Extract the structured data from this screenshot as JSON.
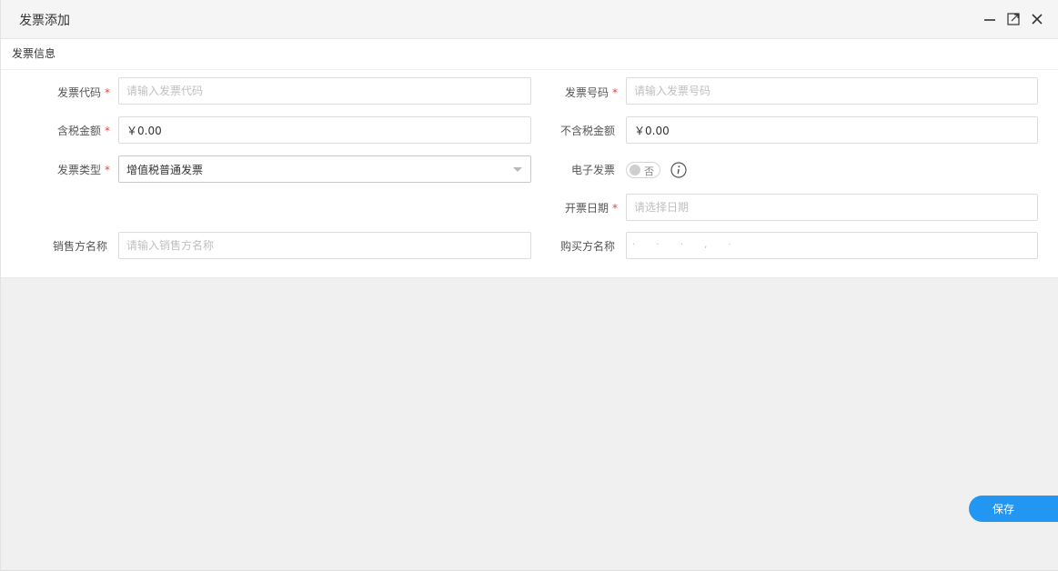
{
  "window": {
    "title": "发票添加",
    "minimize_icon": "minimize-icon",
    "maximize_icon": "maximize-icon",
    "close_icon": "close-icon"
  },
  "section": {
    "title": "发票信息"
  },
  "form": {
    "invoice_code": {
      "label": "发票代码",
      "required": "*",
      "value": "",
      "placeholder": "请输入发票代码"
    },
    "invoice_number": {
      "label": "发票号码",
      "required": "*",
      "value": "",
      "placeholder": "请输入发票号码"
    },
    "amount_incl_tax": {
      "label": "含税金额",
      "required": "*",
      "value": "￥0.00"
    },
    "amount_excl_tax": {
      "label": "不含税金额",
      "value": "￥0.00"
    },
    "invoice_type": {
      "label": "发票类型",
      "required": "*",
      "value": "增值税普通发票"
    },
    "e_invoice": {
      "label": "电子发票",
      "toggle_text": "否",
      "info_icon": "info-icon"
    },
    "issue_date": {
      "label": "开票日期",
      "required": "*",
      "value": "",
      "placeholder": "请选择日期"
    },
    "seller_name": {
      "label": "销售方名称",
      "value": "",
      "placeholder": "请输入销售方名称"
    },
    "buyer_name": {
      "label": "购买方名称",
      "value": "·  ·  ·  ,  ·"
    }
  },
  "actions": {
    "save_label": "保存"
  },
  "colors": {
    "primary": "#2196f3",
    "required": "#e0483d",
    "background": "#f0f0f0"
  }
}
